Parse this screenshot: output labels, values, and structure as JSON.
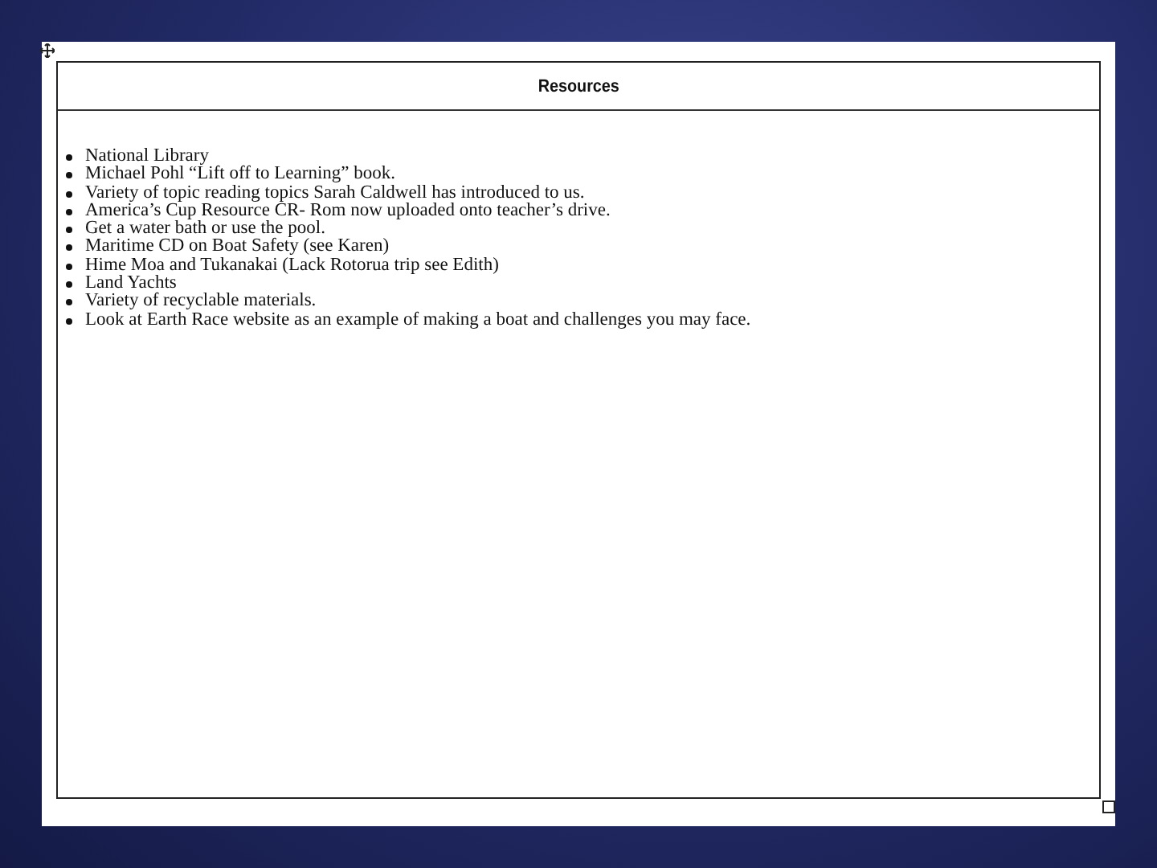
{
  "table": {
    "heading": "Resources",
    "items": [
      "National Library",
      "Michael Pohl “Lift off to Learning” book.",
      "Variety of topic reading topics Sarah Caldwell has introduced to us.",
      "America’s Cup Resource CR- Rom now uploaded onto teacher’s drive.",
      "Get a water bath or use the pool.",
      "Maritime CD on Boat Safety (see Karen)",
      "Hime Moa and Tukanakai (Lack Rotorua trip see Edith)",
      "Land Yachts",
      "Variety of recyclable materials.",
      "Look at Earth Race website as an example of making a boat and challenges you may face."
    ]
  }
}
